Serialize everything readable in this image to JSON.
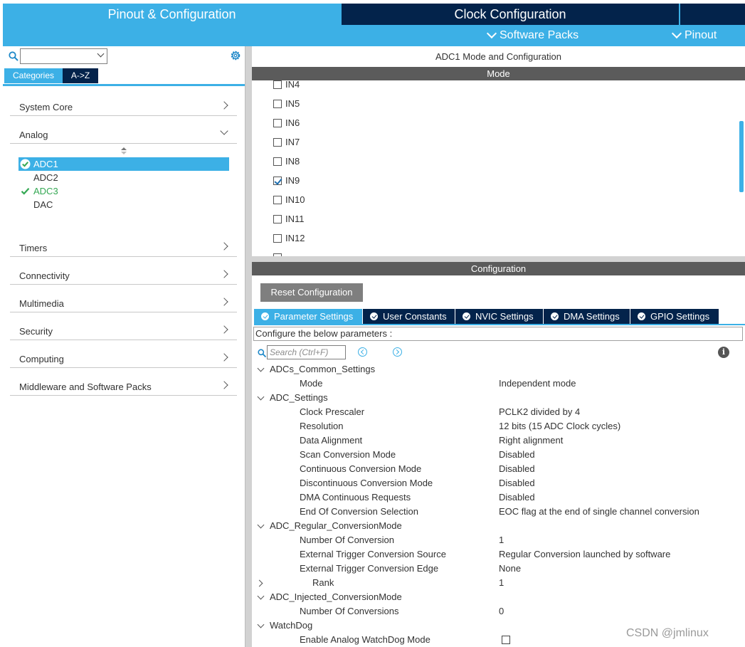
{
  "header": {
    "tab_pinout": "Pinout & Configuration",
    "tab_clock": "Clock Configuration",
    "tab_extra": "",
    "menu_software_packs": "Software Packs",
    "menu_pinout": "Pinout"
  },
  "sidebar": {
    "search_value": "",
    "tab_categories": "Categories",
    "tab_az": "A->Z",
    "categories": [
      {
        "label": "System Core"
      },
      {
        "label": "Analog"
      },
      {
        "label": "Timers"
      },
      {
        "label": "Connectivity"
      },
      {
        "label": "Multimedia"
      },
      {
        "label": "Security"
      },
      {
        "label": "Computing"
      },
      {
        "label": "Middleware and Software Packs"
      }
    ],
    "analog_items": [
      {
        "label": "ADC1",
        "state": "selected"
      },
      {
        "label": "ADC2",
        "state": "none"
      },
      {
        "label": "ADC3",
        "state": "ok"
      },
      {
        "label": "DAC",
        "state": "none"
      }
    ]
  },
  "mode": {
    "title": "ADC1 Mode and Configuration",
    "header": "Mode",
    "inputs": [
      {
        "label": "IN4",
        "checked": false
      },
      {
        "label": "IN5",
        "checked": false
      },
      {
        "label": "IN6",
        "checked": false
      },
      {
        "label": "IN7",
        "checked": false
      },
      {
        "label": "IN8",
        "checked": false
      },
      {
        "label": "IN9",
        "checked": true
      },
      {
        "label": "IN10",
        "checked": false
      },
      {
        "label": "IN11",
        "checked": false
      },
      {
        "label": "IN12",
        "checked": false
      }
    ]
  },
  "config": {
    "header": "Configuration",
    "reset_label": "Reset Configuration",
    "tabs": [
      {
        "label": "Parameter Settings",
        "active": true
      },
      {
        "label": "User Constants",
        "active": false
      },
      {
        "label": "NVIC Settings",
        "active": false
      },
      {
        "label": "DMA Settings",
        "active": false
      },
      {
        "label": "GPIO Settings",
        "active": false
      }
    ],
    "caption": "Configure the below parameters :",
    "search_placeholder": "Search (Ctrl+F)",
    "tree": {
      "common_group": "ADCs_Common_Settings",
      "common_mode_name": "Mode",
      "common_mode_value": "Independent mode",
      "adc_group": "ADC_Settings",
      "clock_prescaler_name": "Clock Prescaler",
      "clock_prescaler_value": "PCLK2 divided by 4",
      "resolution_name": "Resolution",
      "resolution_value": "12 bits (15 ADC Clock cycles)",
      "data_alignment_name": "Data Alignment",
      "data_alignment_value": "Right alignment",
      "scan_mode_name": "Scan Conversion Mode",
      "scan_mode_value": "Disabled",
      "continuous_name": "Continuous Conversion Mode",
      "continuous_value": "Disabled",
      "discontinuous_name": "Discontinuous Conversion Mode",
      "discontinuous_value": "Disabled",
      "dma_cont_name": "DMA Continuous Requests",
      "dma_cont_value": "Disabled",
      "eoc_name": "End Of Conversion Selection",
      "eoc_value": "EOC flag at the end of single channel conversion",
      "regular_group": "ADC_Regular_ConversionMode",
      "num_conv_name": "Number Of Conversion",
      "num_conv_value": "1",
      "ext_src_name": "External Trigger Conversion Source",
      "ext_src_value": "Regular Conversion launched by software",
      "ext_edge_name": "External Trigger Conversion Edge",
      "ext_edge_value": "None",
      "rank_name": "Rank",
      "rank_value": "1",
      "injected_group": "ADC_Injected_ConversionMode",
      "num_convs_name": "Number Of Conversions",
      "num_convs_value": "0",
      "watchdog_group": "WatchDog",
      "watchdog_enable_name": "Enable Analog WatchDog Mode",
      "watchdog_enable_checked": false
    }
  },
  "watermark": "CSDN @jmlinux",
  "colors": {
    "accent": "#3cb0e6",
    "navy": "#03234b",
    "ok_green": "#34a853"
  }
}
